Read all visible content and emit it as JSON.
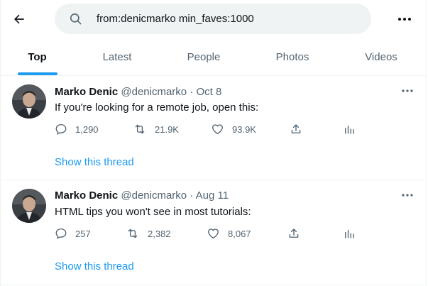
{
  "search": {
    "query": "from:denicmarko min_faves:1000"
  },
  "tabs": [
    "Top",
    "Latest",
    "People",
    "Photos",
    "Videos"
  ],
  "tweets": [
    {
      "name": "Marko Denic",
      "handle": "@denicmarko",
      "sep": "·",
      "date": "Oct 8",
      "text": "If you're looking for a remote job, open this:",
      "replies": "1,290",
      "retweets": "21.9K",
      "likes": "93.9K",
      "show_thread": "Show this thread"
    },
    {
      "name": "Marko Denic",
      "handle": "@denicmarko",
      "sep": "·",
      "date": "Aug 11",
      "text": "HTML tips you won't see in most tutorials:",
      "replies": "257",
      "retweets": "2,382",
      "likes": "8,067",
      "show_thread": "Show this thread"
    }
  ],
  "colors": {
    "accent": "#1d9bf0",
    "muted": "#536471",
    "text": "#0f1419",
    "search_bg": "#eff3f4"
  }
}
